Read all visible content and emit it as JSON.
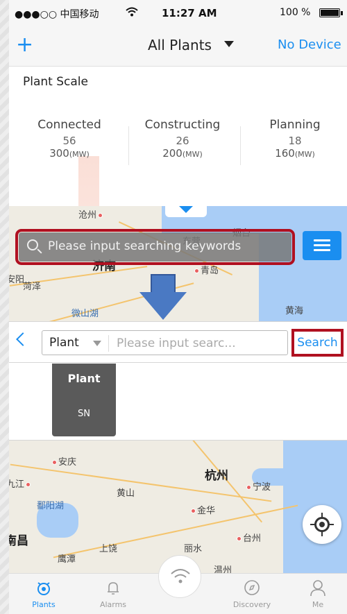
{
  "status_bar": {
    "carrier": "●●●○○ 中国移动",
    "time": "11:27 AM",
    "battery": "100 %"
  },
  "nav": {
    "add_icon": "plus-icon",
    "title": "All Plants",
    "right_label": "No Device"
  },
  "plant_scale": {
    "title": "Plant Scale",
    "stats": [
      {
        "label": "Connected",
        "count": "56",
        "capacity": "300",
        "unit": "(MW)"
      },
      {
        "label": "Constructing",
        "count": "26",
        "capacity": "200",
        "unit": "(MW)"
      },
      {
        "label": "Planning",
        "count": "18",
        "capacity": "160",
        "unit": "(MW)"
      }
    ]
  },
  "map_top": {
    "search_placeholder": "Please input searching keywords",
    "cities": {
      "c1": "沧州",
      "c2": "东营",
      "c3": "烟台",
      "c4": "济南",
      "c5": "青岛",
      "c6": "安阳",
      "c7": "菏泽",
      "c8": "微山湖",
      "c9": "黄海"
    }
  },
  "search_bar": {
    "select_value": "Plant",
    "input_placeholder": "Please input searc...",
    "search_label": "Search"
  },
  "dropdown": {
    "options": [
      "Plant",
      "SN"
    ]
  },
  "map_bottom": {
    "cities": {
      "d1": "安庆",
      "d2": "杭州",
      "d3": "九江",
      "d4": "宁波",
      "d5": "黄山",
      "d6": "鄱阳湖",
      "d7": "金华",
      "d8": "南昌",
      "d9": "台州",
      "d10": "上饶",
      "d11": "丽水",
      "d12": "鹰潭",
      "d13": "温州"
    }
  },
  "tabs": [
    {
      "label": "Plants",
      "icon": "plants-icon",
      "active": true
    },
    {
      "label": "Alarms",
      "icon": "bell-icon",
      "active": false
    },
    {
      "label": "",
      "icon": "wifi-icon",
      "active": false
    },
    {
      "label": "Discovery",
      "icon": "compass-icon",
      "active": false
    },
    {
      "label": "Me",
      "icon": "person-icon",
      "active": false
    }
  ],
  "colors": {
    "accent": "#1a8ef0",
    "annotation_red": "#b01020",
    "annotation_arrow": "#4a79c3"
  }
}
